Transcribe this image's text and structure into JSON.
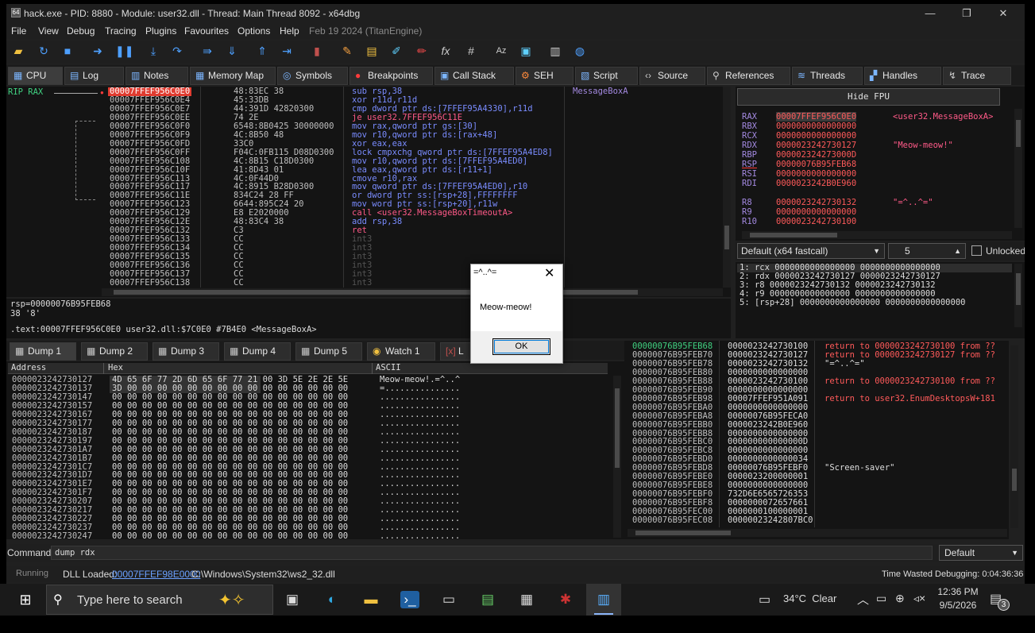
{
  "title": "hack.exe - PID: 8880 - Module: user32.dll - Thread: Main Thread 8092 - x64dbg",
  "window_controls": {
    "minimize": "—",
    "maximize": "❐",
    "close": "✕"
  },
  "menu": [
    "File",
    "View",
    "Debug",
    "Tracing",
    "Plugins",
    "Favourites",
    "Options",
    "Help",
    "Feb 19 2024 (TitanEngine)"
  ],
  "tabs": [
    "CPU",
    "Log",
    "Notes",
    "Memory Map",
    "Symbols",
    "Breakpoints",
    "Call Stack",
    "SEH",
    "Script",
    "Source",
    "References",
    "Threads",
    "Handles",
    "Trace"
  ],
  "disasm": {
    "labels": "RIP RAX",
    "rows": [
      {
        "addr": "00007FFEF956C0E0",
        "bytes": "48:83EC 38",
        "instr": "sub rsp,38",
        "comment": "MessageBoxA"
      },
      {
        "addr": "00007FFEF956C0E4",
        "bytes": "45:33DB",
        "instr": "xor r11d,r11d",
        "comment": ""
      },
      {
        "addr": "00007FFEF956C0E7",
        "bytes": "44:391D 42820300",
        "instr": "cmp dword ptr ds:[7FFEF95A4330],r11d",
        "comment": ""
      },
      {
        "addr": "00007FFEF956C0EE",
        "bytes": "74 2E",
        "instr": "je user32.7FFEF956C11E",
        "comment": ""
      },
      {
        "addr": "00007FFEF956C0F0",
        "bytes": "6548:8B0425 30000000",
        "instr": "mov rax,qword ptr gs:[30]",
        "comment": ""
      },
      {
        "addr": "00007FFEF956C0F9",
        "bytes": "4C:8B50 48",
        "instr": "mov r10,qword ptr ds:[rax+48]",
        "comment": ""
      },
      {
        "addr": "00007FFEF956C0FD",
        "bytes": "33C0",
        "instr": "xor eax,eax",
        "comment": ""
      },
      {
        "addr": "00007FFEF956C0FF",
        "bytes": "F04C:0FB115 D08D0300",
        "instr": "lock cmpxchg qword ptr ds:[7FFEF95A4ED8]",
        "comment": ""
      },
      {
        "addr": "00007FFEF956C108",
        "bytes": "4C:8B15 C18D0300",
        "instr": "mov r10,qword ptr ds:[7FFEF95A4ED0]",
        "comment": ""
      },
      {
        "addr": "00007FFEF956C10F",
        "bytes": "41:8D43 01",
        "instr": "lea eax,qword ptr ds:[r11+1]",
        "comment": ""
      },
      {
        "addr": "00007FFEF956C113",
        "bytes": "4C:0F44D0",
        "instr": "cmove r10,rax",
        "comment": ""
      },
      {
        "addr": "00007FFEF956C117",
        "bytes": "4C:8915 B28D0300",
        "instr": "mov qword ptr ds:[7FFEF95A4ED0],r10",
        "comment": ""
      },
      {
        "addr": "00007FFEF956C11E",
        "bytes": "834C24 28 FF",
        "instr": "or dword ptr ss:[rsp+28],FFFFFFFF",
        "comment": ""
      },
      {
        "addr": "00007FFEF956C123",
        "bytes": "6644:895C24 20",
        "instr": "mov word ptr ss:[rsp+20],r11w",
        "comment": ""
      },
      {
        "addr": "00007FFEF956C129",
        "bytes": "E8 E2020000",
        "instr": "call <user32.MessageBoxTimeoutA>",
        "comment": ""
      },
      {
        "addr": "00007FFEF956C12E",
        "bytes": "48:83C4 38",
        "instr": "add rsp,38",
        "comment": ""
      },
      {
        "addr": "00007FFEF956C132",
        "bytes": "C3",
        "instr": "ret",
        "comment": ""
      },
      {
        "addr": "00007FFEF956C133",
        "bytes": "CC",
        "instr": "int3",
        "comment": ""
      },
      {
        "addr": "00007FFEF956C134",
        "bytes": "CC",
        "instr": "int3",
        "comment": ""
      },
      {
        "addr": "00007FFEF956C135",
        "bytes": "CC",
        "instr": "int3",
        "comment": ""
      },
      {
        "addr": "00007FFEF956C136",
        "bytes": "CC",
        "instr": "int3",
        "comment": ""
      },
      {
        "addr": "00007FFEF956C137",
        "bytes": "CC",
        "instr": "int3",
        "comment": ""
      },
      {
        "addr": "00007FFEF956C138",
        "bytes": "CC",
        "instr": "int3",
        "comment": ""
      }
    ]
  },
  "info": {
    "line1": "rsp=00000076B95FEB68",
    "line2": "38 '8'",
    "line3": ".text:00007FFEF956C0E0 user32.dll:$7C0E0 #7B4E0 <MessageBoxA>"
  },
  "regs": {
    "hide_fpu": "Hide FPU",
    "rows": [
      {
        "name": "RAX",
        "val": "00007FFEF956C0E0",
        "cmt": "<user32.MessageBoxA>"
      },
      {
        "name": "RBX",
        "val": "0000000000000000",
        "cmt": ""
      },
      {
        "name": "RCX",
        "val": "0000000000000000",
        "cmt": ""
      },
      {
        "name": "RDX",
        "val": "0000023242730127",
        "cmt": "\"Meow-meow!\""
      },
      {
        "name": "RBP",
        "val": "000002324273000D",
        "cmt": ""
      },
      {
        "name": "RSP",
        "val": "00000076B95FEB68",
        "cmt": ""
      },
      {
        "name": "RSI",
        "val": "0000000000000000",
        "cmt": ""
      },
      {
        "name": "RDI",
        "val": "0000023242B0E960",
        "cmt": ""
      },
      {
        "name": "",
        "val": "",
        "cmt": ""
      },
      {
        "name": "R8",
        "val": "0000023242730132",
        "cmt": "\"=^..^=\""
      },
      {
        "name": "R9",
        "val": "0000000000000000",
        "cmt": ""
      },
      {
        "name": "R10",
        "val": "0000023242730100",
        "cmt": ""
      }
    ]
  },
  "callconv": {
    "selected": "Default (x64 fastcall)",
    "count": "5",
    "unlocked": "Unlocked"
  },
  "args": [
    "1: rcx 0000000000000000 0000000000000000",
    "2: rdx 0000023242730127 0000023242730127",
    "3: r8 0000023242730132 0000023242730132",
    "4: r9 0000000000000000 0000000000000000",
    "5: [rsp+28] 0000000000000000 0000000000000000"
  ],
  "dump_tabs": [
    "Dump 1",
    "Dump 2",
    "Dump 3",
    "Dump 4",
    "Dump 5",
    "Watch 1",
    "L"
  ],
  "dump": {
    "headers": [
      "Address",
      "Hex",
      "ASCII"
    ],
    "rows": [
      {
        "addr": "0000023242730127",
        "hex": "4D 65 6F 77 2D 6D 65 6F 77 21 00 3D 5E 2E 2E 5E",
        "ascii": "Meow-meow!.=^..^"
      },
      {
        "addr": "0000023242730137",
        "hex": "3D 00 00 00 00 00 00 00 00 00 00 00 00 00 00 00",
        "ascii": "=..............."
      },
      {
        "addr": "0000023242730147",
        "hex": "00 00 00 00 00 00 00 00 00 00 00 00 00 00 00 00",
        "ascii": "................"
      },
      {
        "addr": "0000023242730157",
        "hex": "00 00 00 00 00 00 00 00 00 00 00 00 00 00 00 00",
        "ascii": "................"
      },
      {
        "addr": "0000023242730167",
        "hex": "00 00 00 00 00 00 00 00 00 00 00 00 00 00 00 00",
        "ascii": "................"
      },
      {
        "addr": "0000023242730177",
        "hex": "00 00 00 00 00 00 00 00 00 00 00 00 00 00 00 00",
        "ascii": "................"
      },
      {
        "addr": "0000023242730187",
        "hex": "00 00 00 00 00 00 00 00 00 00 00 00 00 00 00 00",
        "ascii": "................"
      },
      {
        "addr": "0000023242730197",
        "hex": "00 00 00 00 00 00 00 00 00 00 00 00 00 00 00 00",
        "ascii": "................"
      },
      {
        "addr": "00000232427301A7",
        "hex": "00 00 00 00 00 00 00 00 00 00 00 00 00 00 00 00",
        "ascii": "................"
      },
      {
        "addr": "00000232427301B7",
        "hex": "00 00 00 00 00 00 00 00 00 00 00 00 00 00 00 00",
        "ascii": "................"
      },
      {
        "addr": "00000232427301C7",
        "hex": "00 00 00 00 00 00 00 00 00 00 00 00 00 00 00 00",
        "ascii": "................"
      },
      {
        "addr": "00000232427301D7",
        "hex": "00 00 00 00 00 00 00 00 00 00 00 00 00 00 00 00",
        "ascii": "................"
      },
      {
        "addr": "00000232427301E7",
        "hex": "00 00 00 00 00 00 00 00 00 00 00 00 00 00 00 00",
        "ascii": "................"
      },
      {
        "addr": "00000232427301F7",
        "hex": "00 00 00 00 00 00 00 00 00 00 00 00 00 00 00 00",
        "ascii": "................"
      },
      {
        "addr": "0000023242730207",
        "hex": "00 00 00 00 00 00 00 00 00 00 00 00 00 00 00 00",
        "ascii": "................"
      },
      {
        "addr": "0000023242730217",
        "hex": "00 00 00 00 00 00 00 00 00 00 00 00 00 00 00 00",
        "ascii": "................"
      },
      {
        "addr": "0000023242730227",
        "hex": "00 00 00 00 00 00 00 00 00 00 00 00 00 00 00 00",
        "ascii": "................"
      },
      {
        "addr": "0000023242730237",
        "hex": "00 00 00 00 00 00 00 00 00 00 00 00 00 00 00 00",
        "ascii": "................"
      },
      {
        "addr": "0000023242730247",
        "hex": "00 00 00 00 00 00 00 00 00 00 00 00 00 00 00 00",
        "ascii": "................"
      }
    ]
  },
  "stack": [
    {
      "addr": "00000076B95FEB68",
      "val": "0000023242730100",
      "cmt": "return to 0000023242730100 from ??"
    },
    {
      "addr": "00000076B95FEB70",
      "val": "0000023242730127",
      "cmt": "return to 0000023242730127 from ??"
    },
    {
      "addr": "00000076B95FEB78",
      "val": "0000023242730132",
      "cmt": "\"=^..^=\""
    },
    {
      "addr": "00000076B95FEB80",
      "val": "0000000000000000",
      "cmt": ""
    },
    {
      "addr": "00000076B95FEB88",
      "val": "0000023242730100",
      "cmt": "return to 0000023242730100 from ??"
    },
    {
      "addr": "00000076B95FEB90",
      "val": "0000000000000000",
      "cmt": ""
    },
    {
      "addr": "00000076B95FEB98",
      "val": "00007FFEF951A091",
      "cmt": "return to user32.EnumDesktopsW+181"
    },
    {
      "addr": "00000076B95FEBA0",
      "val": "0000000000000000",
      "cmt": ""
    },
    {
      "addr": "00000076B95FEBA8",
      "val": "00000076B95FECA0",
      "cmt": ""
    },
    {
      "addr": "00000076B95FEBB0",
      "val": "0000023242B0E960",
      "cmt": ""
    },
    {
      "addr": "00000076B95FEBB8",
      "val": "0000000000000000",
      "cmt": ""
    },
    {
      "addr": "00000076B95FEBC0",
      "val": "000000000000000D",
      "cmt": ""
    },
    {
      "addr": "00000076B95FEBC8",
      "val": "0000000000000000",
      "cmt": ""
    },
    {
      "addr": "00000076B95FEBD0",
      "val": "0000000000000034",
      "cmt": ""
    },
    {
      "addr": "00000076B95FEBD8",
      "val": "00000076B95FEBF0",
      "cmt": "\"Screen-saver\""
    },
    {
      "addr": "00000076B95FEBE0",
      "val": "0000023200000001",
      "cmt": ""
    },
    {
      "addr": "00000076B95FEBE8",
      "val": "0000000000000000",
      "cmt": ""
    },
    {
      "addr": "00000076B95FEBF0",
      "val": "732D6E6565726353",
      "cmt": ""
    },
    {
      "addr": "00000076B95FEBF8",
      "val": "0000000072657661",
      "cmt": ""
    },
    {
      "addr": "00000076B95FEC00",
      "val": "0000000100000001",
      "cmt": ""
    },
    {
      "addr": "00000076B95FEC08",
      "val": "00000023242807BC0",
      "cmt": ""
    }
  ],
  "command": {
    "label": "Command:",
    "value": "dump rdx",
    "default": "Default"
  },
  "status": {
    "state": "Running",
    "dll_label": "DLL Loaded:",
    "dll_addr": "00007FFEF98E0000",
    "dll_path": "C:\\Windows\\System32\\ws2_32.dll",
    "time": "Time Wasted Debugging: 0:04:36:36"
  },
  "dialog": {
    "title": "=^..^=",
    "message": "Meow-meow!",
    "ok": "OK"
  },
  "taskbar": {
    "search_placeholder": "Type here to search",
    "weather": "34°C  Clear",
    "time": "12:36 PM",
    "date": "9/5/2026",
    "notifications": "3"
  }
}
